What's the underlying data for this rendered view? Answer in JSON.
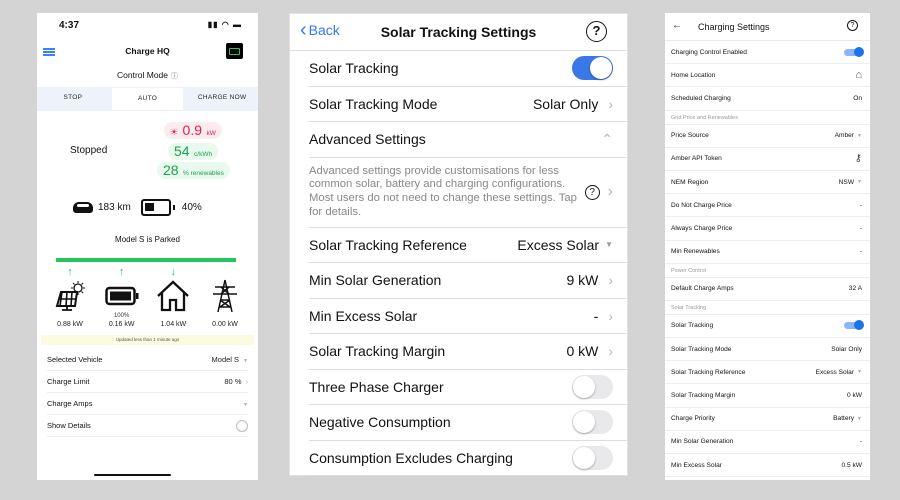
{
  "panel1": {
    "status_time": "4:37",
    "app_title": "Charge HQ",
    "control_mode_label": "Control Mode",
    "modes": [
      "STOP",
      "AUTO",
      "CHARGE NOW"
    ],
    "active_mode": "AUTO",
    "state": "Stopped",
    "solar_value": "0.9",
    "solar_unit": "kW",
    "price_value": "54",
    "price_unit": "c/kWh",
    "renew_value": "28",
    "renew_unit": "% renewables",
    "range": "183 km",
    "battery_pct": "40%",
    "vehicle_status": "Model S is Parked",
    "flow": [
      {
        "name": "solar",
        "icon": "solar-panel-icon",
        "arrow": "↑",
        "sub": "",
        "kw": "0.88 kW"
      },
      {
        "name": "battery",
        "icon": "home-battery-icon",
        "arrow": "↑",
        "sub": "100%",
        "kw": "0.16 kW"
      },
      {
        "name": "home",
        "icon": "house-icon",
        "arrow": "↓",
        "sub": "",
        "kw": "1.04 kW"
      },
      {
        "name": "grid",
        "icon": "power-pylon-icon",
        "arrow": "",
        "sub": "",
        "kw": "0.00 kW"
      }
    ],
    "updated": "Updated less than 1 minute ago",
    "settings": [
      {
        "label": "Selected Vehicle",
        "value": "Model S",
        "accessory": "caret"
      },
      {
        "label": "Charge Limit",
        "value": "80 %",
        "accessory": "chevron"
      },
      {
        "label": "Charge Amps",
        "value": "",
        "accessory": "caret"
      },
      {
        "label": "Show Details",
        "value": "",
        "accessory": "radio"
      }
    ]
  },
  "panel2": {
    "back_label": "Back",
    "title": "Solar Tracking Settings",
    "rows": [
      {
        "label": "Solar Tracking",
        "type": "toggle",
        "on": true
      },
      {
        "label": "Solar Tracking Mode",
        "type": "chevron",
        "value": "Solar Only"
      },
      {
        "label": "Advanced Settings",
        "type": "collapse",
        "value": ""
      }
    ],
    "advanced_desc": "Advanced settings provide customisations for less common solar, battery and charging configurations. Most users do not need to change these settings. Tap for details.",
    "rows2": [
      {
        "label": "Solar Tracking Reference",
        "type": "caret",
        "value": "Excess Solar"
      },
      {
        "label": "Min Solar Generation",
        "type": "chevron",
        "value": "9 kW"
      },
      {
        "label": "Min Excess Solar",
        "type": "chevron",
        "value": "-"
      },
      {
        "label": "Solar Tracking Margin",
        "type": "chevron",
        "value": "0 kW"
      },
      {
        "label": "Three Phase Charger",
        "type": "toggle",
        "on": false
      },
      {
        "label": "Negative Consumption",
        "type": "toggle",
        "on": false
      },
      {
        "label": "Consumption Excludes Charging",
        "type": "toggle",
        "on": false
      }
    ]
  },
  "panel3": {
    "title": "Charging Settings",
    "items": [
      {
        "kind": "row",
        "label": "Charging Control Enabled",
        "accessory": "toggle"
      },
      {
        "kind": "row",
        "label": "Home Location",
        "accessory": "home"
      },
      {
        "kind": "row",
        "label": "Scheduled Charging",
        "value": "On"
      },
      {
        "kind": "section",
        "label": "Grid Price and Renewables"
      },
      {
        "kind": "row",
        "label": "Price Source",
        "value": "Amber",
        "accessory": "caret"
      },
      {
        "kind": "row",
        "label": "Amber API Token",
        "accessory": "key"
      },
      {
        "kind": "row",
        "label": "NEM Region",
        "value": "NSW",
        "accessory": "caret"
      },
      {
        "kind": "row",
        "label": "Do Not Charge Price",
        "value": "-"
      },
      {
        "kind": "row",
        "label": "Always Charge Price",
        "value": "-"
      },
      {
        "kind": "row",
        "label": "Min Renewables",
        "value": "-"
      },
      {
        "kind": "section",
        "label": "Power Control"
      },
      {
        "kind": "row",
        "label": "Default Charge Amps",
        "value": "32 A"
      },
      {
        "kind": "section",
        "label": "Solar Tracking"
      },
      {
        "kind": "row",
        "label": "Solar Tracking",
        "accessory": "toggle"
      },
      {
        "kind": "row",
        "label": "Solar Tracking Mode",
        "value": "Solar Only"
      },
      {
        "kind": "row",
        "label": "Solar Tracking Reference",
        "value": "Excess Solar",
        "accessory": "caret"
      },
      {
        "kind": "row",
        "label": "Solar Tracking Margin",
        "value": "0 kW"
      },
      {
        "kind": "row",
        "label": "Charge Priority",
        "value": "Battery",
        "accessory": "caret"
      },
      {
        "kind": "row",
        "label": "Min Solar Generation",
        "value": "-"
      },
      {
        "kind": "row",
        "label": "Min Excess Solar",
        "value": "0.5 kW"
      }
    ]
  }
}
